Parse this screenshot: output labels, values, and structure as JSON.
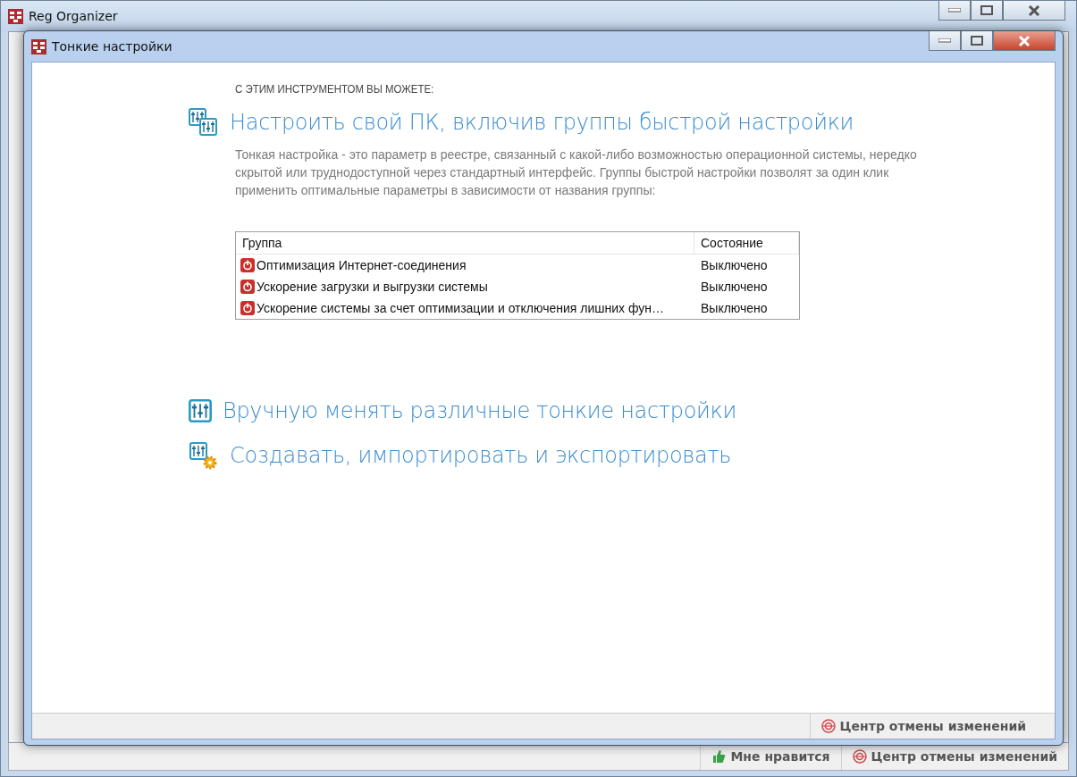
{
  "main_window": {
    "title": "Reg Organizer",
    "status_bar": [
      {
        "kind": "like",
        "label": "Мне нравится"
      },
      {
        "kind": "undo",
        "label": "Центр отмены изменений"
      }
    ]
  },
  "dialog": {
    "title": "Тонкие настройки",
    "intro": "С ЭТИМ ИНСТРУМЕНТОМ ВЫ МОЖЕТЕ:",
    "sections": [
      {
        "kind": "groups",
        "title": "Настроить свой ПК, включив группы быстрой настройки",
        "description": "Тонкая настройка - это параметр в реестре, связанный с какой-либо возможностью операционной системы, нередко скрытой или труднодоступной через стандартный интерфейс. Группы быстрой настройки позволят за один клик применить оптимальные параметры в зависимости от названия группы:",
        "table": {
          "columns": [
            "Группа",
            "Состояние"
          ],
          "rows": [
            {
              "group": "Оптимизация Интернет-соединения",
              "state": "Выключено",
              "on": false
            },
            {
              "group": "Ускорение загрузки и выгрузки системы",
              "state": "Выключено",
              "on": false
            },
            {
              "group": "Ускорение системы за счет оптимизации и отключения лишних фун…",
              "state": "Выключено",
              "on": false
            }
          ]
        }
      },
      {
        "kind": "manual",
        "title": "Вручную менять различные тонкие настройки"
      },
      {
        "kind": "create",
        "title": "Создавать, импортировать и экспортировать"
      }
    ],
    "status_bar": [
      {
        "kind": "undo",
        "label": "Центр отмены изменений"
      }
    ]
  }
}
